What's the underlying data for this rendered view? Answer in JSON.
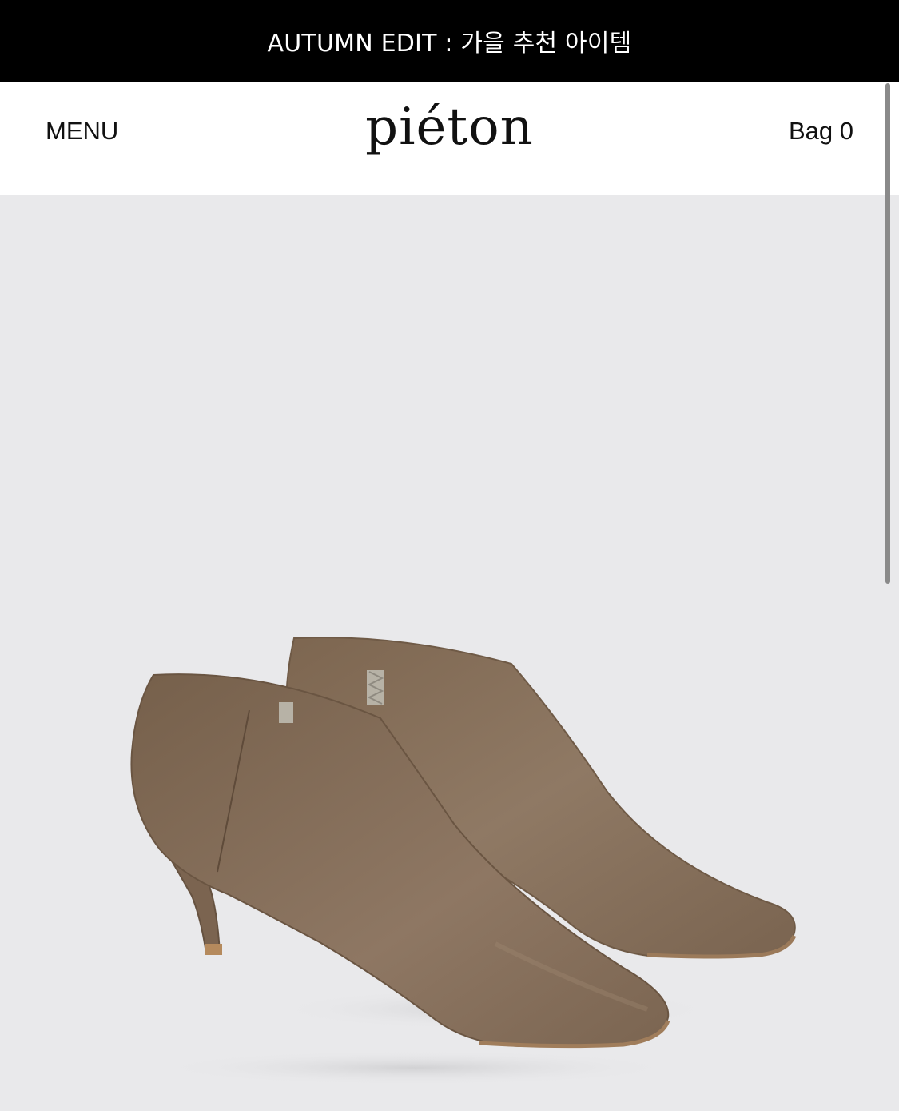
{
  "announcement": {
    "text": "AUTUMN EDIT : 가을 추천 아이템"
  },
  "header": {
    "menu_label": "MENU",
    "logo_text": "piéton",
    "bag_label": "Bag 0"
  },
  "hero": {
    "image_subject": "taupe leather square-toe kitten-heel ankle boots",
    "background_color": "#e9e9eb"
  },
  "colors": {
    "announcement_bg": "#000000",
    "boot_leather": "#8c7560",
    "lining": "#c9c9bd"
  }
}
